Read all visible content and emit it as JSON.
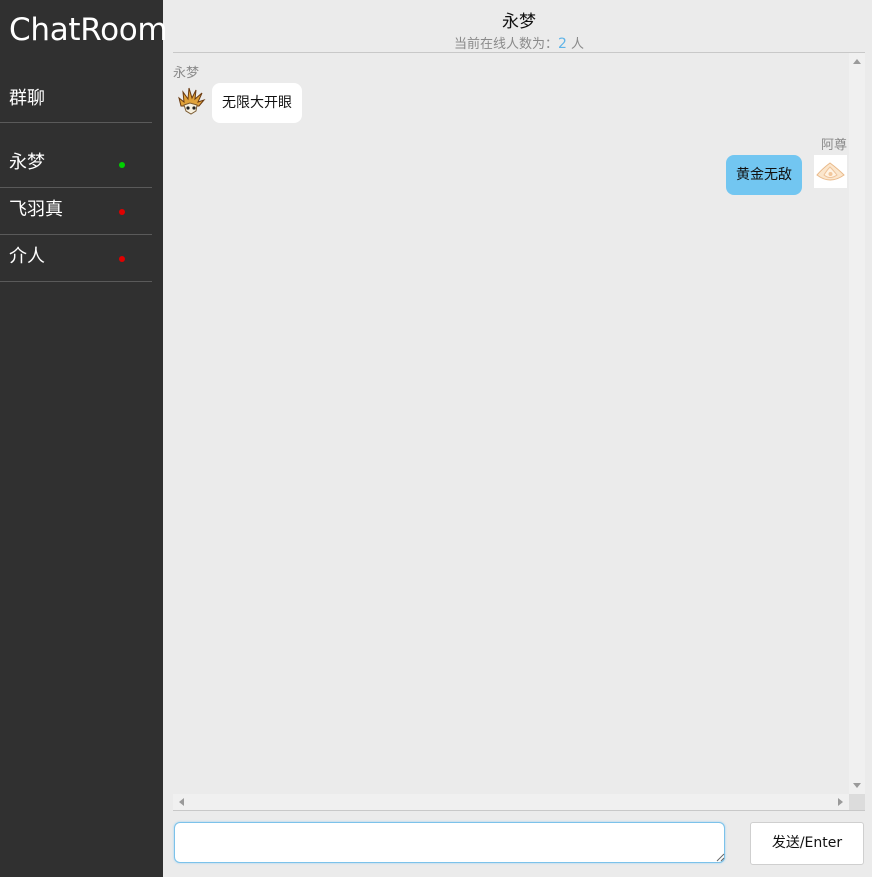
{
  "app": {
    "title": "ChatRoom"
  },
  "sidebar": {
    "group": {
      "label": "群聊"
    },
    "users": [
      {
        "name": "永梦",
        "status": "online",
        "status_color": "#00d000"
      },
      {
        "name": "飞羽真",
        "status": "offline",
        "status_color": "#e00000"
      },
      {
        "name": "介人",
        "status": "offline",
        "status_color": "#e00000"
      }
    ]
  },
  "chat": {
    "title": "永梦",
    "online_prefix": "当前在线人数为：",
    "online_count": "2",
    "online_suffix": "人",
    "messages": [
      {
        "sender": "永梦",
        "text": "无限大开眼",
        "side": "left",
        "avatar_icon": "spiky-mask-icon"
      },
      {
        "sender": "阿尊",
        "text": "黄金无敌",
        "side": "right",
        "avatar_icon": "golden-crest-icon"
      }
    ]
  },
  "composer": {
    "input_value": "",
    "send_label": "发送/Enter"
  },
  "colors": {
    "sidebar_bg": "#303030",
    "chat_bg": "#ebebeb",
    "bubble_self": "#72c6f1",
    "bubble_other": "#ffffff",
    "accent": "#5fb4e8",
    "online": "#00d000",
    "offline": "#e00000"
  }
}
